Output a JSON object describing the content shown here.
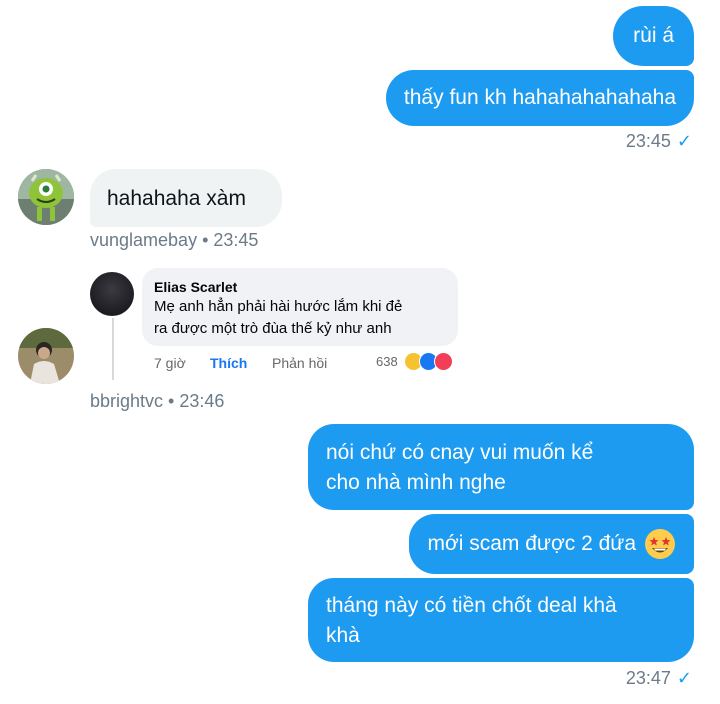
{
  "messages_top": {
    "m1": "rùi á",
    "m2": "thấy fun kh hahahahahahaha",
    "time": "23:45",
    "check": "✓"
  },
  "incoming1": {
    "text": "hahahaha xàm",
    "meta": "vunglamebay • 23:45"
  },
  "incoming2": {
    "meta": "bbrightvc • 23:46",
    "fb_comment": {
      "name": "Elias Scarlet",
      "line1": "Mẹ anh hẳn phải hài hước lắm khi đẻ",
      "line2": "ra được một trò đùa thế kỷ như anh",
      "time": "7 giờ",
      "like": "Thích",
      "reply": "Phản hồi",
      "reaction_count": "638"
    }
  },
  "messages_bottom": {
    "m1_line1": "nói chứ có cnay vui muốn kể",
    "m1_line2": "cho nhà mình nghe",
    "m2": "mới scam được 2 đứa",
    "m3_line1": "tháng này có tiền chốt deal khà",
    "m3_line2": "khà",
    "time": "23:47",
    "check": "✓"
  },
  "colors": {
    "outgoing": "#1d9bf0",
    "incoming": "#eff3f4",
    "meta": "#6b7b88"
  }
}
